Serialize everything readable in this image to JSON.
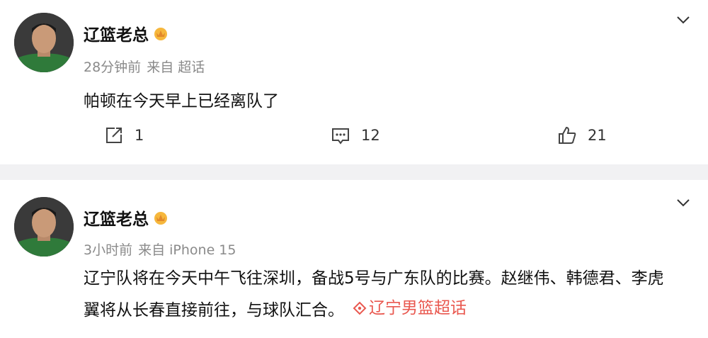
{
  "posts": [
    {
      "author": "辽篮老总",
      "time": "28分钟前",
      "source": "来自 超话",
      "text": "帕顿在今天早上已经离队了",
      "actions": {
        "repost": "1",
        "comment": "12",
        "like": "21"
      }
    },
    {
      "author": "辽篮老总",
      "time": "3小时前",
      "source": "来自 iPhone 15",
      "text_line1": "辽宁队将在今天中午飞往深圳，备战5号与广东队的比赛。赵继伟、韩德君、李虎",
      "text_line2": "翼将从长春直接前往，与球队汇合。",
      "topic": "辽宁男篮超话"
    }
  ],
  "colors": {
    "accent": "#e9584f",
    "meta": "#8a8a8a",
    "divider": "#f1f1f3"
  },
  "icons": [
    "crown-badge-icon",
    "chevron-down-icon",
    "repost-icon",
    "comment-icon",
    "like-icon",
    "topic-diamond-icon"
  ]
}
